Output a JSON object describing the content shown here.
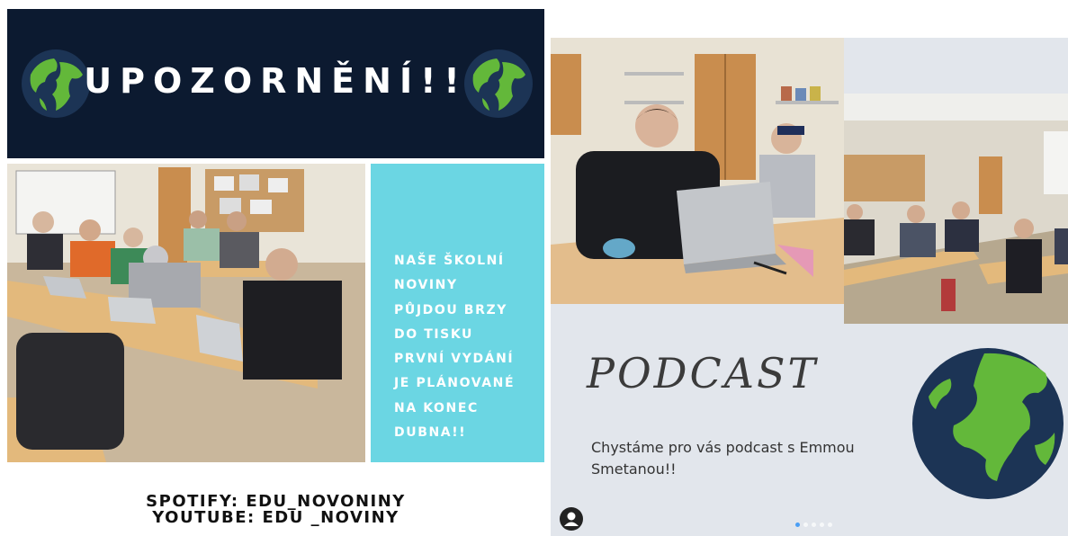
{
  "left_post": {
    "banner": {
      "title": "UPOZORNĚNÍ!!"
    },
    "notice": {
      "lines": [
        "NAŠE ŠKOLNÍ",
        "NOVINY",
        "PŮJDOU BRZY",
        "DO TISKU",
        "PRVNÍ VYDÁNÍ",
        "JE PLÁNOVANÉ",
        "NA KONEC",
        "DUBNA!!"
      ]
    },
    "social": {
      "spotify": "SPOTIFY: EDU_NOVONINY",
      "youtube": "YOUTUBE: EDU _NOVINY"
    }
  },
  "right_post": {
    "title": "PODCAST",
    "description": "Chystáme pro vás podcast s Emmou Smetanou!!",
    "carousel": {
      "count": 5,
      "active_index": 0
    }
  },
  "colors": {
    "banner": "#0c1a30",
    "notice_box": "#6bd6e3",
    "right_bg": "#e2e6ec",
    "globe_ocean": "#1c3455",
    "globe_land": "#63b83a"
  }
}
